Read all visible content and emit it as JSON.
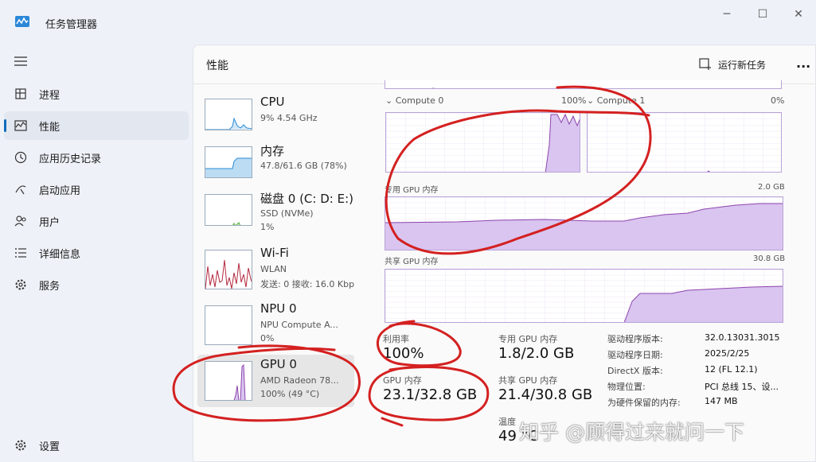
{
  "window": {
    "title": "任务管理器"
  },
  "nav": {
    "items": [
      {
        "label": "进程",
        "icon": "processes-icon"
      },
      {
        "label": "性能",
        "icon": "performance-icon",
        "active": true
      },
      {
        "label": "应用历史记录",
        "icon": "app-history-icon"
      },
      {
        "label": "启动应用",
        "icon": "startup-icon"
      },
      {
        "label": "用户",
        "icon": "users-icon"
      },
      {
        "label": "详细信息",
        "icon": "details-icon"
      },
      {
        "label": "服务",
        "icon": "services-icon"
      }
    ],
    "settings_label": "设置"
  },
  "header": {
    "title": "性能",
    "run_task_label": "运行新任务",
    "more": "..."
  },
  "devices": [
    {
      "name": "CPU",
      "line1": "9% 4.54 GHz",
      "line2": ""
    },
    {
      "name": "内存",
      "line1": "47.8/61.6 GB (78%)",
      "line2": ""
    },
    {
      "name": "磁盘 0 (C: D: E:)",
      "line1": "SSD (NVMe)",
      "line2": "1%"
    },
    {
      "name": "Wi-Fi",
      "line1": "WLAN",
      "line2": "发送: 0 接收: 16.0 Kbp"
    },
    {
      "name": "NPU 0",
      "line1": "NPU Compute A...",
      "line2": "0%"
    },
    {
      "name": "GPU 0",
      "line1": "AMD Radeon 78...",
      "line2": "100% (49 °C)",
      "active": true
    }
  ],
  "gpu": {
    "compute0": {
      "label": "Compute 0",
      "pct": "100%"
    },
    "compute1": {
      "label": "Compute 1",
      "pct": "0%"
    },
    "dedicated": {
      "label": "专用 GPU 内存",
      "max": "2.0 GB"
    },
    "shared": {
      "label": "共享 GPU 内存",
      "max": "30.8 GB"
    },
    "stats": {
      "util_label": "利用率",
      "util_value": "100%",
      "ded_label": "专用 GPU 内存",
      "ded_value": "1.8/2.0 GB",
      "gpumem_label": "GPU 内存",
      "gpumem_value": "23.1/32.8 GB",
      "shared_label": "共享 GPU 内存",
      "shared_value": "21.4/30.8 GB",
      "temp_label": "温度",
      "temp_value": "49 °C"
    },
    "props": [
      {
        "k": "驱动程序版本:",
        "v": "32.0.13031.3015"
      },
      {
        "k": "驱动程序日期:",
        "v": "2025/2/25"
      },
      {
        "k": "DirectX 版本:",
        "v": "12 (FL 12.1)"
      },
      {
        "k": "物理位置:",
        "v": "PCI 总线 15、设..."
      },
      {
        "k": "为硬件保留的内存:",
        "v": "147 MB"
      }
    ]
  },
  "watermark": "知乎 @顾得过来就问一下",
  "colors": {
    "accent": "#0f6cbd",
    "gpu": "#8e44ad",
    "gpu_fill": "#d9c5f0",
    "annotation": "#d42020"
  }
}
